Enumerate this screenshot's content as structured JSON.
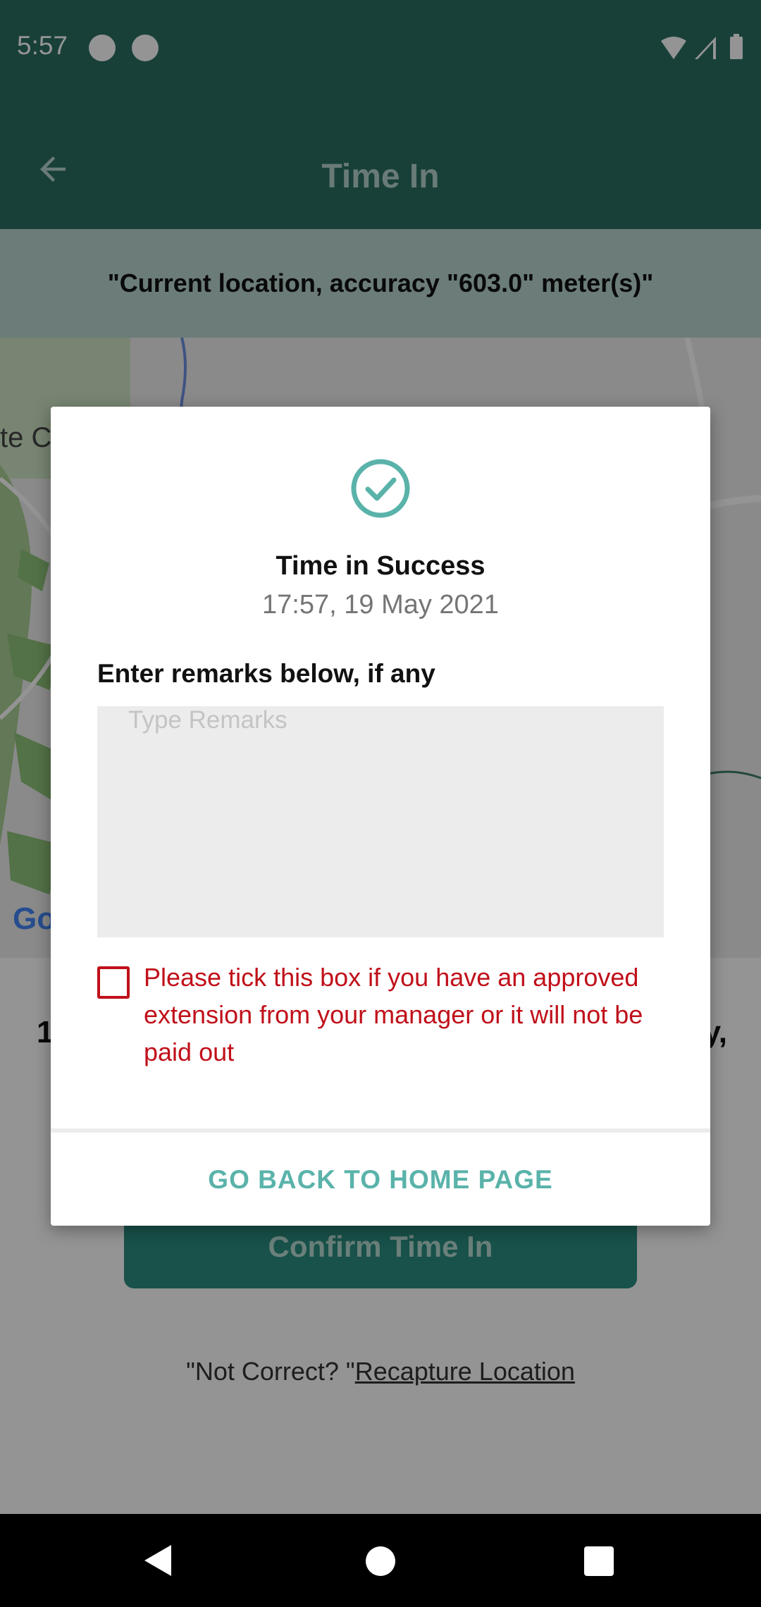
{
  "status_bar": {
    "time": "5:57",
    "icons": [
      "notification-dot-icon",
      "notification-dot-icon",
      "wifi-icon",
      "signal-icon",
      "battery-icon"
    ]
  },
  "app_bar": {
    "title": "Time In",
    "back_icon": "arrow-back-icon"
  },
  "location_banner": {
    "text": "\"Current location, accuracy \"603.0\" meter(s)\""
  },
  "map": {
    "google_logo": "Go",
    "partial_label": "te Cr"
  },
  "background_content": {
    "partial_left": "1",
    "partial_right": "y,",
    "confirm_button_label": "Confirm Time In",
    "recapture_prefix": "\"Not Correct? \"",
    "recapture_link": "Recapture Location"
  },
  "dialog": {
    "icon": "check-circle-icon",
    "title": "Time in Success",
    "datetime": "17:57, 19 May 2021",
    "remarks_label": "Enter remarks below, if any",
    "remarks_placeholder": "Type Remarks",
    "remarks_value": "",
    "extension_checked": false,
    "extension_text": "Please tick this box if you have an approved extension from your manager or it will not be paid out",
    "home_button_label": "GO BACK TO HOME PAGE"
  },
  "colors": {
    "header_teal": "#2a6e62",
    "accent_teal": "#5ab3aa",
    "warning_red": "#c0101a"
  },
  "nav_bar": {
    "icons": [
      "nav-back-icon",
      "nav-home-icon",
      "nav-recents-icon"
    ]
  }
}
